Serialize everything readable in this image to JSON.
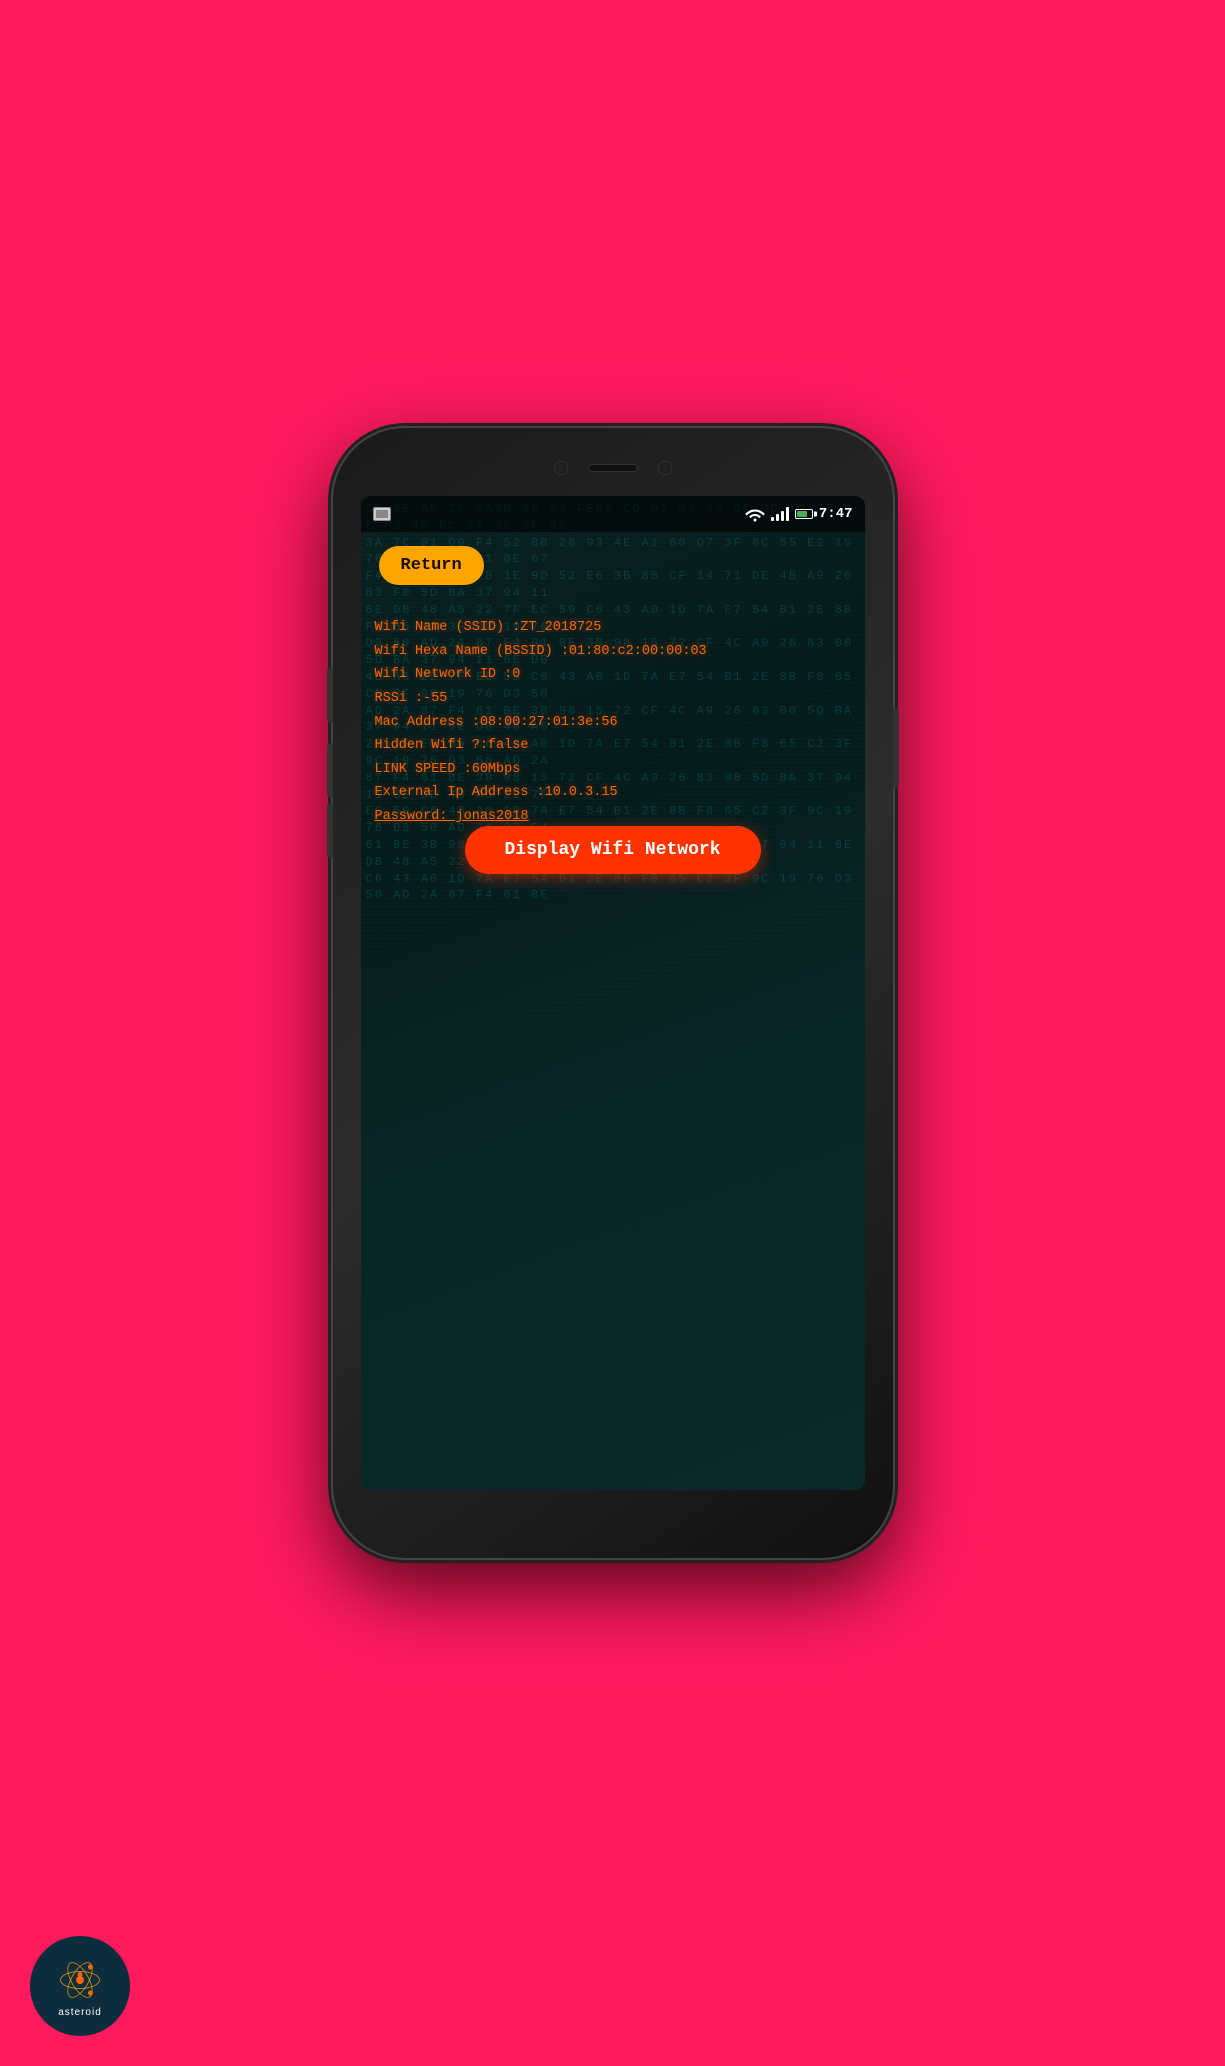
{
  "background_color": "#ff1a5e",
  "status_bar": {
    "time": "7:47",
    "wifi": true,
    "signal": true,
    "battery": true
  },
  "return_button": {
    "label": "Return"
  },
  "wifi_info": {
    "ssid_label": "Wifi Name (SSID) :ZT_2018725",
    "bssid_label": "Wifi Hexa Name (BSSID) :01:80:c2:00:00:03",
    "network_id_label": "Wifi Network ID :0",
    "rssi_label": "RSSi :-55",
    "mac_label": "Mac Address :08:00:27:01:3e:56",
    "hidden_label": "Hidden Wifi ?:false",
    "link_speed_label": "LINK SPEED :60Mbps",
    "external_ip_label": "External Ip Address :10.0.3.15",
    "password_label": "Password: jonas2018"
  },
  "display_button": {
    "label": "Display Wifi Network"
  },
  "asteroid": {
    "label": "asteroid"
  },
  "hex_background": "8F 9E A5 2F 6A3B 88 67 FE8A CD 01 B4 33 5C 9D 12 77 EE F0 45 BC 2A 90 8F 6E\n3A 7C 01 D9 F4 52 BB 28 93 4E A1 60 D7 3F 8C 55 E2 19 76 CD 4A B3 21 8E 67\nF4 C0 35 A8 7B 1E 9D 52 E6 3B 88 CF 14 71 DE 4B A9 26 83 F0 5D BA 37 94 11\n6E DB 48 A5 22 7F EC 59 C6 43 A0 1D 7A E7 54 B1 2E 8B F8 65 C2 3F 9C 19 76\nD3 50 AD 2A 87 F4 61 BE 3B 98 15 72 CF 4C A9 26 83 00 5D BA 37 94 11 6E DB\n48 A5 22 7F EC 59 C6 43 A0 1D 7A E7 54 B1 2E 8B F8 65 C2 3F 9C 19 76 D3 50\nAD 2A 87 F4 61 BE 3B 98 15 72 CF 4C A9 26 83 00 5D BA 37 94 11 6E DB 48 A5\n22 7F EC 59 C6 43 A0 1D 7A E7 54 B1 2E 8B F8 65 C2 3F 9C 19 76 D3 50 AD 2A\n87 F4 61 BE 3B 98 15 72 CF 4C A9 26 83 00 5D BA 37 94 11 6E DB 48 A5 22 7F\nEC 59 C6 43 A0 1D 7A E7 54 B1 2E 8B F8 65 C2 3F 9C 19 76 D3 50 AD 2A 87 F4\n61 BE 3B 98 15 72 CF 4C A9 26 83 00 5D BA 37 94 11 6E DB 48 A5 22 7F EC 59\nC6 43 A0 1D 7A E7 54 B1 2E 8B F8 65 C2 3F 9C 19 76 D3 50 AD 2A 87 F4 61 BE"
}
